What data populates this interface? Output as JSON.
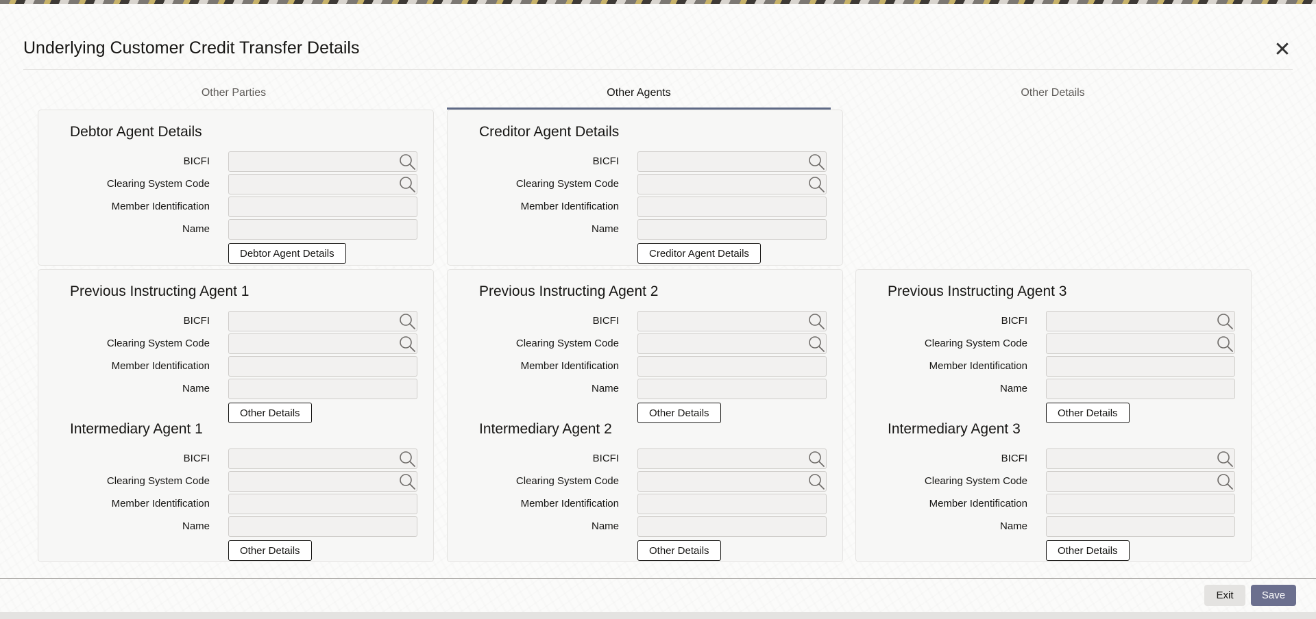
{
  "dialog": {
    "title": "Underlying Customer Credit Transfer Details",
    "close_icon": "close-icon"
  },
  "tabs": [
    {
      "label": "Other Parties",
      "active": false
    },
    {
      "label": "Other Agents",
      "active": true
    },
    {
      "label": "Other Details",
      "active": false
    }
  ],
  "field_labels": {
    "bicfi": "BICFI",
    "clearing_system_code": "Clearing System Code",
    "member_identification": "Member Identification",
    "name": "Name"
  },
  "sections": {
    "debtor_agent": {
      "title": "Debtor Agent Details",
      "button": "Debtor Agent Details"
    },
    "creditor_agent": {
      "title": "Creditor Agent Details",
      "button": "Creditor Agent Details"
    },
    "prev_agent_1": {
      "title": "Previous Instructing Agent 1",
      "button": "Other Details"
    },
    "prev_agent_2": {
      "title": "Previous Instructing Agent 2",
      "button": "Other Details"
    },
    "prev_agent_3": {
      "title": "Previous Instructing Agent 3",
      "button": "Other Details"
    },
    "inter_agent_1": {
      "title": "Intermediary Agent 1",
      "button": "Other Details"
    },
    "inter_agent_2": {
      "title": "Intermediary Agent 2",
      "button": "Other Details"
    },
    "inter_agent_3": {
      "title": "Intermediary Agent 3",
      "button": "Other Details"
    }
  },
  "field_values": {
    "bicfi": "",
    "clearing_system_code": "",
    "member_identification": "",
    "name": ""
  },
  "footer": {
    "exit_label": "Exit",
    "save_label": "Save"
  },
  "icons": {
    "lookup": "search-icon"
  },
  "colors": {
    "accent": "#5f6a86",
    "save_bg": "#6b6f8e",
    "exit_bg": "#e4e3e1"
  }
}
